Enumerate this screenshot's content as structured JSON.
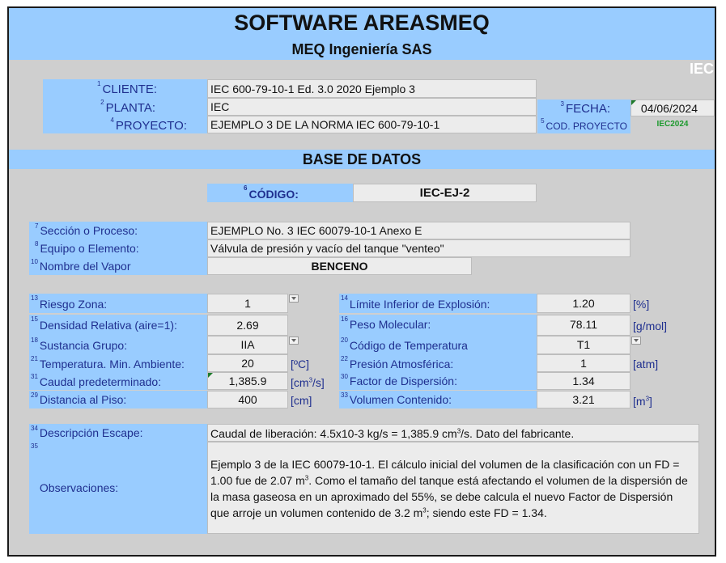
{
  "header": {
    "title": "SOFTWARE AREASMEQ",
    "company": "MEQ Ingeniería SAS",
    "tag": "IEC"
  },
  "info": {
    "cliente_num": "1",
    "cliente_label": "CLIENTE:",
    "cliente_value": "IEC 600-79-10-1 Ed. 3.0 2020 Ejemplo 3",
    "planta_num": "2",
    "planta_label": "PLANTA:",
    "planta_value": "IEC",
    "proyecto_num": "4",
    "proyecto_label": "PROYECTO:",
    "proyecto_value": "EJEMPLO 3 DE LA NORMA IEC 600-79-10-1",
    "fecha_num": "3",
    "fecha_label": "FECHA:",
    "fecha_value": "04/06/2024",
    "cod_num": "5",
    "cod_label": "COD. PROYECTO",
    "cod_value": "IEC2024"
  },
  "section_title": "BASE DE DATOS",
  "codigo": {
    "num": "6",
    "label": "CÓDIGO:",
    "value": "IEC-EJ-2"
  },
  "general": [
    {
      "num": "7",
      "label": "Sección o Proceso:",
      "value": "EJEMPLO No. 3 IEC 60079-10-1 Anexo E"
    },
    {
      "num": "8",
      "label": "Equipo o Elemento:",
      "value": "Válvula de presión y vacío del tanque \"venteo\""
    },
    {
      "num": "10",
      "label": "Nombre del Vapor",
      "value": "BENCENO"
    }
  ],
  "left_params": [
    {
      "num": "13",
      "label": "Riesgo Zona:",
      "value": "1",
      "unit": ""
    },
    {
      "num": "15",
      "label": "Densidad Relativa (aire=1):",
      "value": "2.69",
      "unit": ""
    },
    {
      "num": "18",
      "label": "Sustancia Grupo:",
      "value": "IIA",
      "unit": ""
    },
    {
      "num": "21",
      "label": "Temperatura. Min. Ambiente:",
      "value": "20",
      "unit": "[ºC]"
    },
    {
      "num": "31",
      "label": "Caudal predeterminado:",
      "value": "1,385.9",
      "unit_pre": "[cm",
      "unit_sup": "3",
      "unit_post": "/s]"
    },
    {
      "num": "29",
      "label": "Distancia al Piso:",
      "value": "400",
      "unit": "[cm]"
    }
  ],
  "right_params": [
    {
      "num": "14",
      "label": "Límite Inferior de Explosión:",
      "value": "1.20",
      "unit": "[%]"
    },
    {
      "num": "16",
      "label": "Peso Molecular:",
      "value": "78.11",
      "unit": "[g/mol]"
    },
    {
      "num": "20",
      "label": "Código de Temperatura",
      "value": "T1",
      "unit": ""
    },
    {
      "num": "22",
      "label": "Presión Atmosférica:",
      "value": "1",
      "unit": "[atm]"
    },
    {
      "num": "30",
      "label": "Factor de Dispersión:",
      "value": "1.34",
      "unit": ""
    },
    {
      "num": "33",
      "label": "Volumen Contenido:",
      "value": "3.21",
      "unit_pre": "[m",
      "unit_sup": "3",
      "unit_post": "]"
    }
  ],
  "escape": {
    "num": "34",
    "label": "Descripción Escape:",
    "pre": "Caudal de liberación: 4.5x10-3 kg/s = 1,385.9 cm",
    "sup": "3",
    "post": "/s. Dato del fabricante."
  },
  "obs": {
    "num": "35",
    "label": "Observaciones:",
    "t1": "Ejemplo 3 de la IEC 60079-10-1. El cálculo inicial del volumen de la clasificación con un FD = 1.00 fue de 2.07 m",
    "s1": "3",
    "t2": ". Como el tamaño del tanque está afectando el volumen de la dispersión de la masa gaseosa en un aproximado del 55%, se debe calcula el nuevo Factor de Dispersión que arroje un volumen contenido de 3.2 m",
    "s2": "3",
    "t3": "; siendo este FD = 1.34."
  },
  "colors": {
    "band": "#99ccff",
    "label_text": "#1f2f8f",
    "bg": "#cfcfcf",
    "cell": "#ececec",
    "green": "#1d9a2e"
  }
}
